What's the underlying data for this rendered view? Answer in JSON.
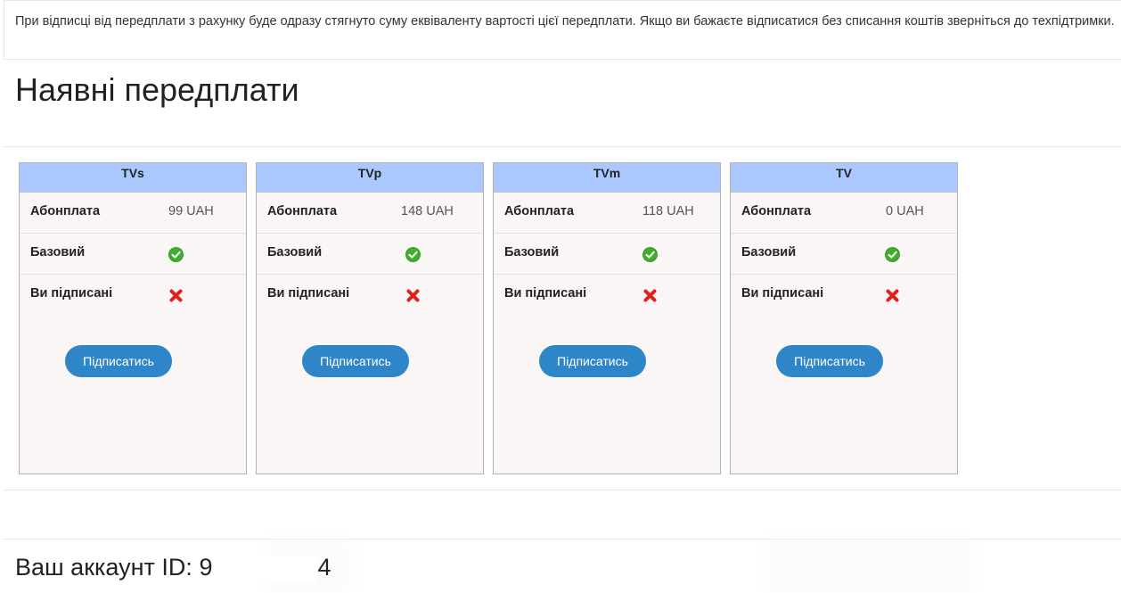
{
  "notice": {
    "text": "При відписці від передплати з рахунку буде одразу стягнуто суму еквіваленту вартості цієї передплати. Якщо ви бажаєте відписатися без списання коштів зверніться до техпідтримки."
  },
  "section": {
    "title": "Наявні передплати"
  },
  "labels": {
    "fee": "Абонплата",
    "basic": "Базовий",
    "subscribed": "Ви підписані",
    "subscribe_button": "Підписатись"
  },
  "plans": [
    {
      "name": "TVs",
      "fee": "99 UAH",
      "basic": "check-icon",
      "subscribed": "cross-icon"
    },
    {
      "name": "TVp",
      "fee": "148 UAH",
      "basic": "check-icon",
      "subscribed": "cross-icon"
    },
    {
      "name": "TVm",
      "fee": "118 UAH",
      "basic": "check-icon",
      "subscribed": "cross-icon"
    },
    {
      "name": "TV",
      "fee": "0 UAH",
      "basic": "check-icon",
      "subscribed": "cross-icon"
    }
  ],
  "account": {
    "label": "Ваш аккаунт ID:",
    "id_start": "9",
    "id_end": "4"
  },
  "colors": {
    "card_header": "#aac8ff",
    "card_body": "#f9f6f5",
    "button": "#2e86c8",
    "check": "#3fae2a",
    "cross": "#e0201c"
  }
}
